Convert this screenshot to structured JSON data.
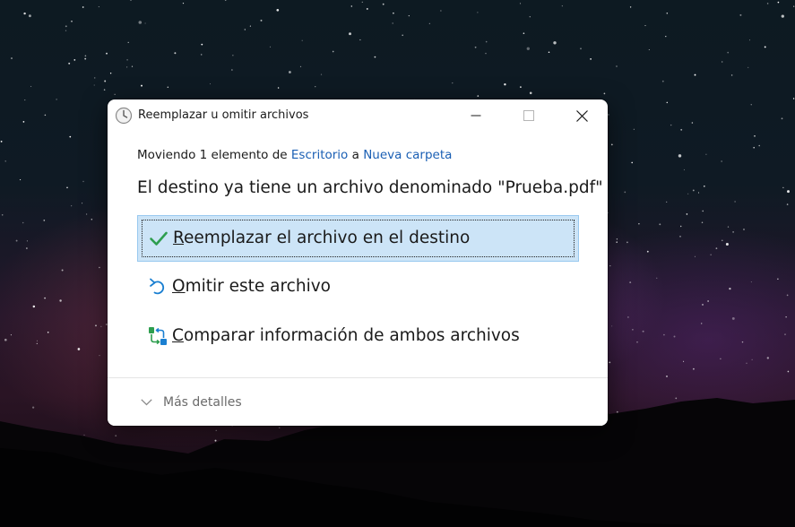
{
  "dialog": {
    "title": "Reemplazar u omitir archivos",
    "moving": {
      "prefix": "Moviendo 1 elemento de",
      "source": "Escritorio",
      "middle": "a",
      "destination": "Nueva carpeta"
    },
    "heading": "El destino ya tiene un archivo denominado \"Prueba.pdf\"",
    "options": [
      {
        "accel": "R",
        "rest": "eemplazar el archivo en el destino",
        "icon": "checkmark-icon",
        "selected": true
      },
      {
        "accel": "O",
        "rest": "mitir este archivo",
        "icon": "undo-arrow-icon",
        "selected": false
      },
      {
        "accel": "C",
        "rest": "omparar información de ambos archivos",
        "icon": "compare-files-icon",
        "selected": false
      }
    ],
    "details_label": "Más detalles"
  },
  "colors": {
    "link": "#1a5fb4",
    "selected_bg": "#cce4f7",
    "selected_border": "#99c9ef",
    "check": "#2e9e4f",
    "undo": "#1a7fd1"
  }
}
